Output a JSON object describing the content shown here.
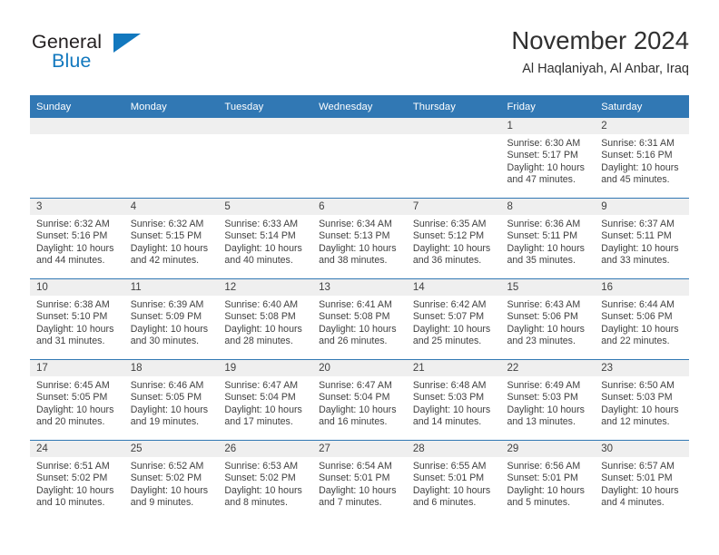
{
  "brand": {
    "name_part1": "General",
    "name_part2": "Blue",
    "accent_color": "#1278be",
    "triangle_icon": "triangle-icon"
  },
  "header": {
    "title": "November 2024",
    "subtitle": "Al Haqlaniyah, Al Anbar, Iraq"
  },
  "theme": {
    "header_blue": "#3178b4",
    "daystrip_gray": "#efefef",
    "text_color": "#404040"
  },
  "weekday_headers": [
    "Sunday",
    "Monday",
    "Tuesday",
    "Wednesday",
    "Thursday",
    "Friday",
    "Saturday"
  ],
  "weeks": [
    [
      {
        "day": "",
        "sunrise": "",
        "sunset": "",
        "daylight_line1": "",
        "daylight_line2": ""
      },
      {
        "day": "",
        "sunrise": "",
        "sunset": "",
        "daylight_line1": "",
        "daylight_line2": ""
      },
      {
        "day": "",
        "sunrise": "",
        "sunset": "",
        "daylight_line1": "",
        "daylight_line2": ""
      },
      {
        "day": "",
        "sunrise": "",
        "sunset": "",
        "daylight_line1": "",
        "daylight_line2": ""
      },
      {
        "day": "",
        "sunrise": "",
        "sunset": "",
        "daylight_line1": "",
        "daylight_line2": ""
      },
      {
        "day": "1",
        "sunrise": "Sunrise: 6:30 AM",
        "sunset": "Sunset: 5:17 PM",
        "daylight_line1": "Daylight: 10 hours",
        "daylight_line2": "and 47 minutes."
      },
      {
        "day": "2",
        "sunrise": "Sunrise: 6:31 AM",
        "sunset": "Sunset: 5:16 PM",
        "daylight_line1": "Daylight: 10 hours",
        "daylight_line2": "and 45 minutes."
      }
    ],
    [
      {
        "day": "3",
        "sunrise": "Sunrise: 6:32 AM",
        "sunset": "Sunset: 5:16 PM",
        "daylight_line1": "Daylight: 10 hours",
        "daylight_line2": "and 44 minutes."
      },
      {
        "day": "4",
        "sunrise": "Sunrise: 6:32 AM",
        "sunset": "Sunset: 5:15 PM",
        "daylight_line1": "Daylight: 10 hours",
        "daylight_line2": "and 42 minutes."
      },
      {
        "day": "5",
        "sunrise": "Sunrise: 6:33 AM",
        "sunset": "Sunset: 5:14 PM",
        "daylight_line1": "Daylight: 10 hours",
        "daylight_line2": "and 40 minutes."
      },
      {
        "day": "6",
        "sunrise": "Sunrise: 6:34 AM",
        "sunset": "Sunset: 5:13 PM",
        "daylight_line1": "Daylight: 10 hours",
        "daylight_line2": "and 38 minutes."
      },
      {
        "day": "7",
        "sunrise": "Sunrise: 6:35 AM",
        "sunset": "Sunset: 5:12 PM",
        "daylight_line1": "Daylight: 10 hours",
        "daylight_line2": "and 36 minutes."
      },
      {
        "day": "8",
        "sunrise": "Sunrise: 6:36 AM",
        "sunset": "Sunset: 5:11 PM",
        "daylight_line1": "Daylight: 10 hours",
        "daylight_line2": "and 35 minutes."
      },
      {
        "day": "9",
        "sunrise": "Sunrise: 6:37 AM",
        "sunset": "Sunset: 5:11 PM",
        "daylight_line1": "Daylight: 10 hours",
        "daylight_line2": "and 33 minutes."
      }
    ],
    [
      {
        "day": "10",
        "sunrise": "Sunrise: 6:38 AM",
        "sunset": "Sunset: 5:10 PM",
        "daylight_line1": "Daylight: 10 hours",
        "daylight_line2": "and 31 minutes."
      },
      {
        "day": "11",
        "sunrise": "Sunrise: 6:39 AM",
        "sunset": "Sunset: 5:09 PM",
        "daylight_line1": "Daylight: 10 hours",
        "daylight_line2": "and 30 minutes."
      },
      {
        "day": "12",
        "sunrise": "Sunrise: 6:40 AM",
        "sunset": "Sunset: 5:08 PM",
        "daylight_line1": "Daylight: 10 hours",
        "daylight_line2": "and 28 minutes."
      },
      {
        "day": "13",
        "sunrise": "Sunrise: 6:41 AM",
        "sunset": "Sunset: 5:08 PM",
        "daylight_line1": "Daylight: 10 hours",
        "daylight_line2": "and 26 minutes."
      },
      {
        "day": "14",
        "sunrise": "Sunrise: 6:42 AM",
        "sunset": "Sunset: 5:07 PM",
        "daylight_line1": "Daylight: 10 hours",
        "daylight_line2": "and 25 minutes."
      },
      {
        "day": "15",
        "sunrise": "Sunrise: 6:43 AM",
        "sunset": "Sunset: 5:06 PM",
        "daylight_line1": "Daylight: 10 hours",
        "daylight_line2": "and 23 minutes."
      },
      {
        "day": "16",
        "sunrise": "Sunrise: 6:44 AM",
        "sunset": "Sunset: 5:06 PM",
        "daylight_line1": "Daylight: 10 hours",
        "daylight_line2": "and 22 minutes."
      }
    ],
    [
      {
        "day": "17",
        "sunrise": "Sunrise: 6:45 AM",
        "sunset": "Sunset: 5:05 PM",
        "daylight_line1": "Daylight: 10 hours",
        "daylight_line2": "and 20 minutes."
      },
      {
        "day": "18",
        "sunrise": "Sunrise: 6:46 AM",
        "sunset": "Sunset: 5:05 PM",
        "daylight_line1": "Daylight: 10 hours",
        "daylight_line2": "and 19 minutes."
      },
      {
        "day": "19",
        "sunrise": "Sunrise: 6:47 AM",
        "sunset": "Sunset: 5:04 PM",
        "daylight_line1": "Daylight: 10 hours",
        "daylight_line2": "and 17 minutes."
      },
      {
        "day": "20",
        "sunrise": "Sunrise: 6:47 AM",
        "sunset": "Sunset: 5:04 PM",
        "daylight_line1": "Daylight: 10 hours",
        "daylight_line2": "and 16 minutes."
      },
      {
        "day": "21",
        "sunrise": "Sunrise: 6:48 AM",
        "sunset": "Sunset: 5:03 PM",
        "daylight_line1": "Daylight: 10 hours",
        "daylight_line2": "and 14 minutes."
      },
      {
        "day": "22",
        "sunrise": "Sunrise: 6:49 AM",
        "sunset": "Sunset: 5:03 PM",
        "daylight_line1": "Daylight: 10 hours",
        "daylight_line2": "and 13 minutes."
      },
      {
        "day": "23",
        "sunrise": "Sunrise: 6:50 AM",
        "sunset": "Sunset: 5:03 PM",
        "daylight_line1": "Daylight: 10 hours",
        "daylight_line2": "and 12 minutes."
      }
    ],
    [
      {
        "day": "24",
        "sunrise": "Sunrise: 6:51 AM",
        "sunset": "Sunset: 5:02 PM",
        "daylight_line1": "Daylight: 10 hours",
        "daylight_line2": "and 10 minutes."
      },
      {
        "day": "25",
        "sunrise": "Sunrise: 6:52 AM",
        "sunset": "Sunset: 5:02 PM",
        "daylight_line1": "Daylight: 10 hours",
        "daylight_line2": "and 9 minutes."
      },
      {
        "day": "26",
        "sunrise": "Sunrise: 6:53 AM",
        "sunset": "Sunset: 5:02 PM",
        "daylight_line1": "Daylight: 10 hours",
        "daylight_line2": "and 8 minutes."
      },
      {
        "day": "27",
        "sunrise": "Sunrise: 6:54 AM",
        "sunset": "Sunset: 5:01 PM",
        "daylight_line1": "Daylight: 10 hours",
        "daylight_line2": "and 7 minutes."
      },
      {
        "day": "28",
        "sunrise": "Sunrise: 6:55 AM",
        "sunset": "Sunset: 5:01 PM",
        "daylight_line1": "Daylight: 10 hours",
        "daylight_line2": "and 6 minutes."
      },
      {
        "day": "29",
        "sunrise": "Sunrise: 6:56 AM",
        "sunset": "Sunset: 5:01 PM",
        "daylight_line1": "Daylight: 10 hours",
        "daylight_line2": "and 5 minutes."
      },
      {
        "day": "30",
        "sunrise": "Sunrise: 6:57 AM",
        "sunset": "Sunset: 5:01 PM",
        "daylight_line1": "Daylight: 10 hours",
        "daylight_line2": "and 4 minutes."
      }
    ]
  ]
}
